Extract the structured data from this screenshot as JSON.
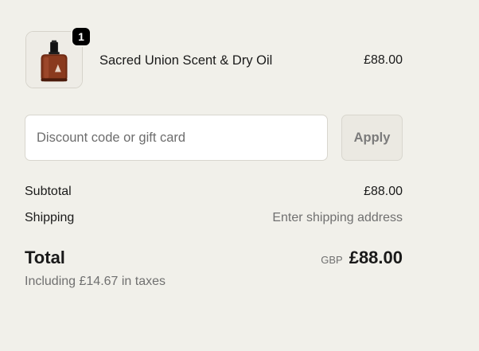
{
  "product": {
    "quantity": "1",
    "name": "Sacred Union Scent & Dry Oil",
    "price": "£88.00",
    "thumbnail_icon": "perfume-bottle-icon"
  },
  "discount": {
    "placeholder": "Discount code or gift card",
    "value": "",
    "apply_label": "Apply"
  },
  "totals": {
    "subtotal_label": "Subtotal",
    "subtotal_value": "£88.00",
    "shipping_label": "Shipping",
    "shipping_value": "Enter shipping address",
    "total_label": "Total",
    "currency": "GBP",
    "total_value": "£88.00",
    "tax_note": "Including £14.67 in taxes"
  },
  "colors": {
    "page_background": "#f1f0ea",
    "badge": "#000000",
    "bottle_amber": "#8a3a1e"
  }
}
